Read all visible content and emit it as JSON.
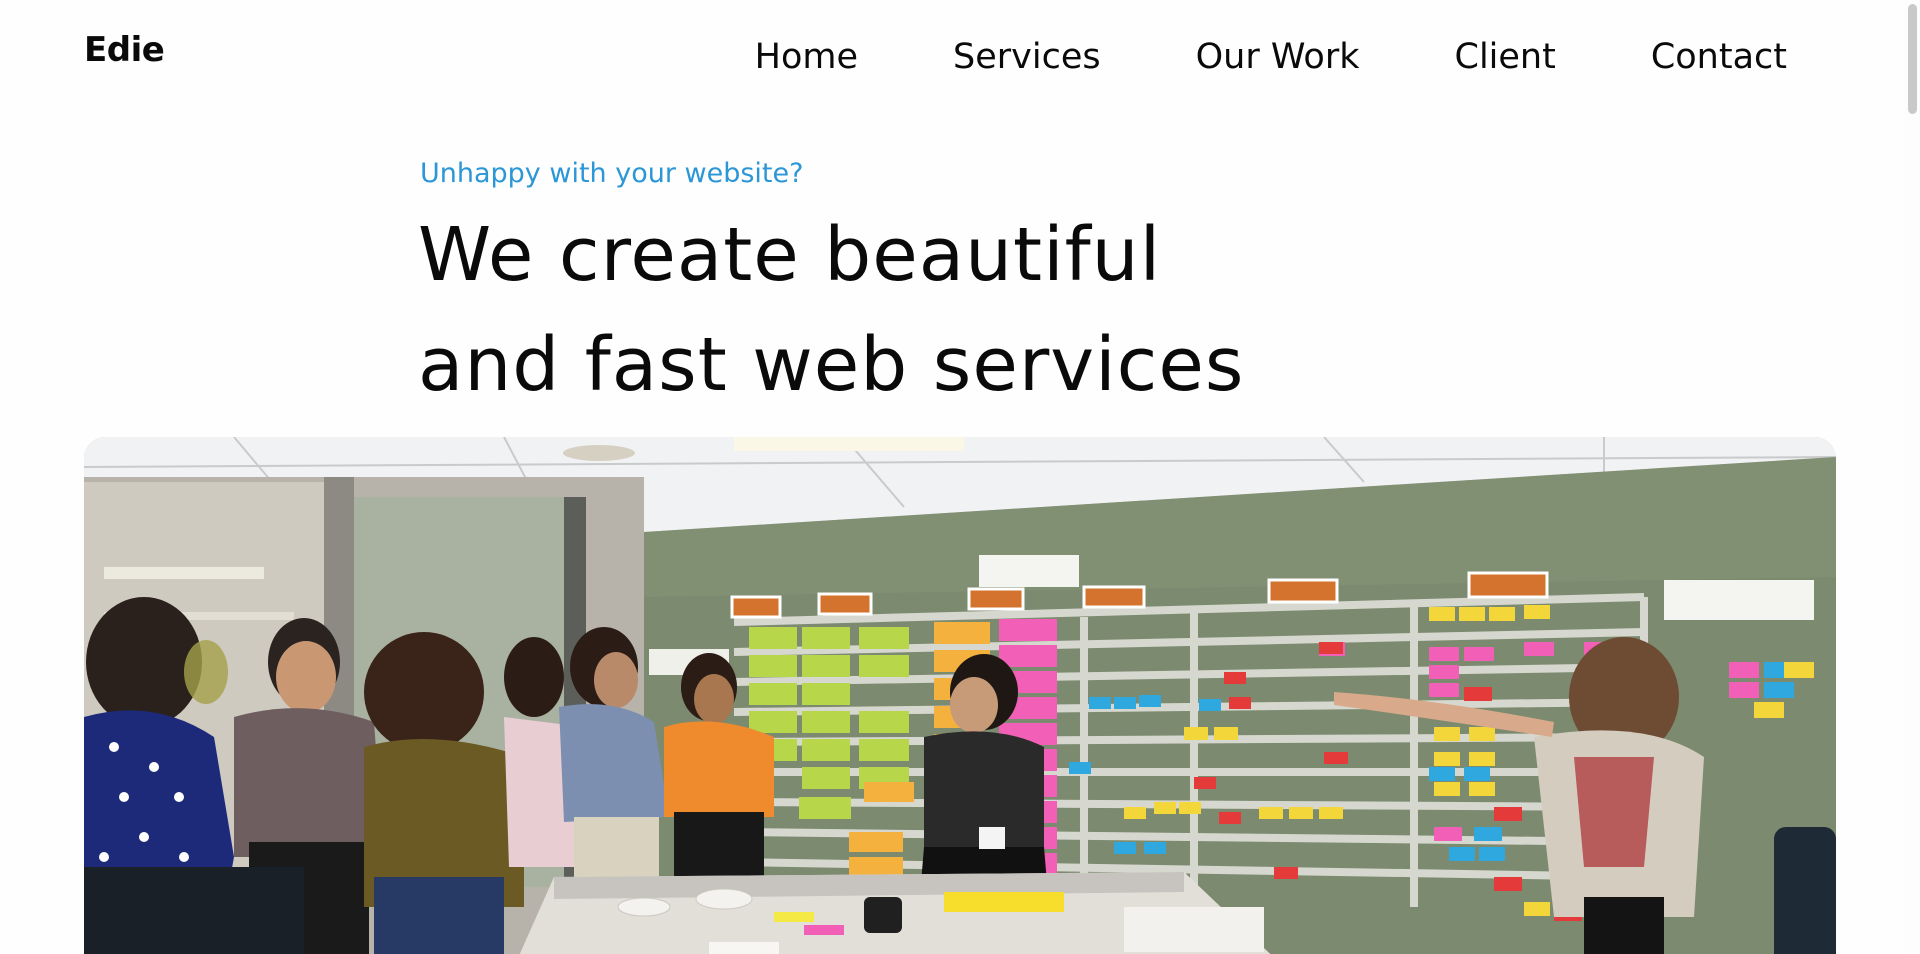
{
  "header": {
    "logo": "Edie",
    "nav": [
      {
        "label": "Home"
      },
      {
        "label": "Services"
      },
      {
        "label": "Our Work"
      },
      {
        "label": "Client"
      },
      {
        "label": "Contact"
      }
    ]
  },
  "hero": {
    "eyebrow": "Unhappy with your website?",
    "headline_line1": "We create beautiful",
    "headline_line2": "and fast web services",
    "image_alt": "Team gathered around a wall of sticky notes in an office"
  },
  "colors": {
    "accent": "#2b97d6",
    "text": "#0a0a0a",
    "background": "#fefefe"
  }
}
